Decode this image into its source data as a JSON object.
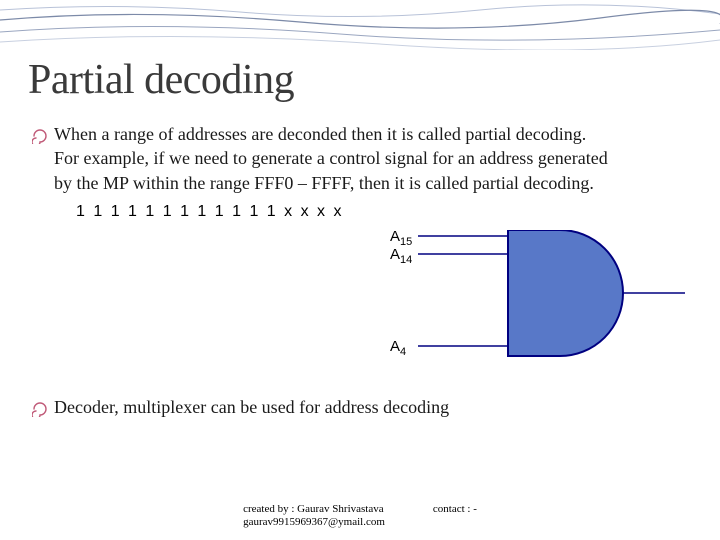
{
  "title": "Partial decoding",
  "bullet1": "When a range of addresses are deconded then it is called partial decoding. For example, if we need to generate a control signal for an address generated by the MP within the range FFF0 – FFFF, then it is called partial decoding.",
  "bit_pattern": "1 1 1 1  1 1 1 1  1 1 1 1  x x x x",
  "gate": {
    "label_top": "A",
    "sub_top": "15",
    "label_mid": "A",
    "sub_mid": "14",
    "label_bot": "A",
    "sub_bot": "4"
  },
  "bullet2": "Decoder, multiplexer can be used for address decoding",
  "footer": {
    "created_by": "created by : Gaurav Shrivastava",
    "email": "gaurav9915969367@ymail.com",
    "contact": "contact : -"
  },
  "colors": {
    "accent_line": "#7c8aa8",
    "bullet_stroke": "#c05a78",
    "gate_stroke": "#000080",
    "gate_fill": "#5878c8"
  }
}
